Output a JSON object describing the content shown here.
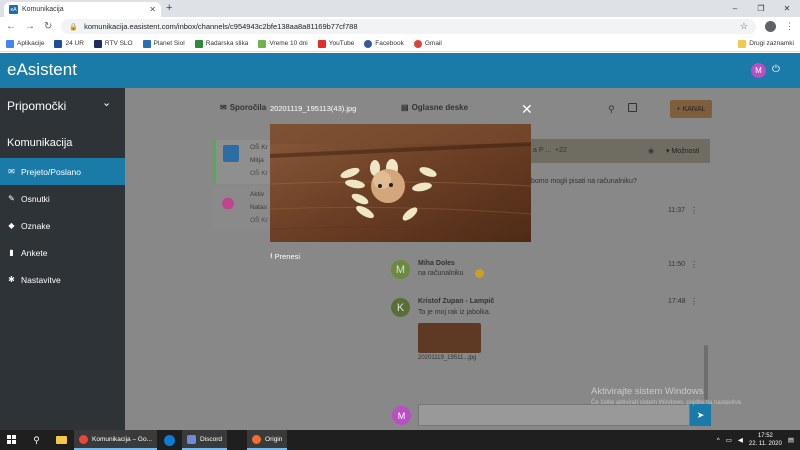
{
  "browser": {
    "tab_title": "Komunikacija",
    "url": "komunikacija.easistent.com/inbox/channels/c954943c2bfe138aa8a81169b77cf788",
    "bookmarks": [
      {
        "label": "Aplikacije",
        "color": "#4285f4"
      },
      {
        "label": "24 UR",
        "color": "#1f4e9c"
      },
      {
        "label": "RTV SLO",
        "color": "#1e2e63"
      },
      {
        "label": "Planet Siol",
        "color": "#2d6fb4"
      },
      {
        "label": "Radarska slika",
        "color": "#2f8a3a"
      },
      {
        "label": "Vreme 10 dni",
        "color": "#6fb34a"
      },
      {
        "label": "YouTube",
        "color": "#e52d27"
      },
      {
        "label": "Facebook",
        "color": "#3b5998"
      },
      {
        "label": "Gmail",
        "color": "#db4437"
      }
    ],
    "other_bookmarks": "Drugi zaznamki"
  },
  "app": {
    "brand": "eAsistent",
    "user_initial": "M",
    "accent": "#1a7aa8"
  },
  "sidebar": {
    "title": "Pripomočki",
    "section": "Komunikacija",
    "items": [
      {
        "label": "Prejeto/Poslano",
        "icon": "envelope-icon",
        "glyph": "✉",
        "active": true
      },
      {
        "label": "Osnutki",
        "icon": "pencil-icon",
        "glyph": "✎",
        "active": false
      },
      {
        "label": "Oznake",
        "icon": "tag-icon",
        "glyph": "◆",
        "active": false
      },
      {
        "label": "Ankete",
        "icon": "chart-icon",
        "glyph": "▮",
        "active": false
      },
      {
        "label": "Nastavitve",
        "icon": "gear-icon",
        "glyph": "✱",
        "active": false
      }
    ]
  },
  "toolbar": {
    "tab_messages": "Sporočila",
    "tab_board": "Oglasne deske",
    "kanal_label": "KANAL",
    "options_label": "Možnosti",
    "topic_count": "+22",
    "topic_preview": "a P ..."
  },
  "conversations": [
    {
      "line1": "OŠ Kr",
      "line2": "Mitja",
      "line3": "OŠ Kr"
    },
    {
      "line1": "Aktiv",
      "line2": "Natas",
      "line3": "OŠ Kr"
    }
  ],
  "messages": [
    {
      "text_fragment": "bomo mogli pisati na računalniku?"
    },
    {
      "time": "11:37"
    },
    {
      "author": "Miha Doles",
      "initial": "M",
      "text": "na računalniku",
      "time": "11:50"
    },
    {
      "author": "Kristof Zupan - Lampič",
      "initial": "K",
      "text": "To je moj rak iz jabolka.",
      "time": "17:48",
      "attachment": "20201119_19511...jpg"
    }
  ],
  "lightbox": {
    "title": "20201119_195113(43).jpg",
    "download_label": "Prenesi"
  },
  "watermark": {
    "line1": "Aktivirajte sistem Windows",
    "line2": "Če želite aktivirati sistem Windows, pojdite na nastavitve."
  },
  "taskbar": {
    "apps": [
      {
        "label": "Komunikacija – Go...",
        "color": "#e8453c",
        "active": true
      },
      {
        "label": "",
        "color": "#0f7bd4",
        "active": false
      },
      {
        "label": "Discord",
        "color": "#7289da",
        "active": true
      },
      {
        "label": "Origin",
        "color": "#f56c2d",
        "active": true
      }
    ],
    "time": "17:52",
    "date": "22. 11. 2020"
  }
}
